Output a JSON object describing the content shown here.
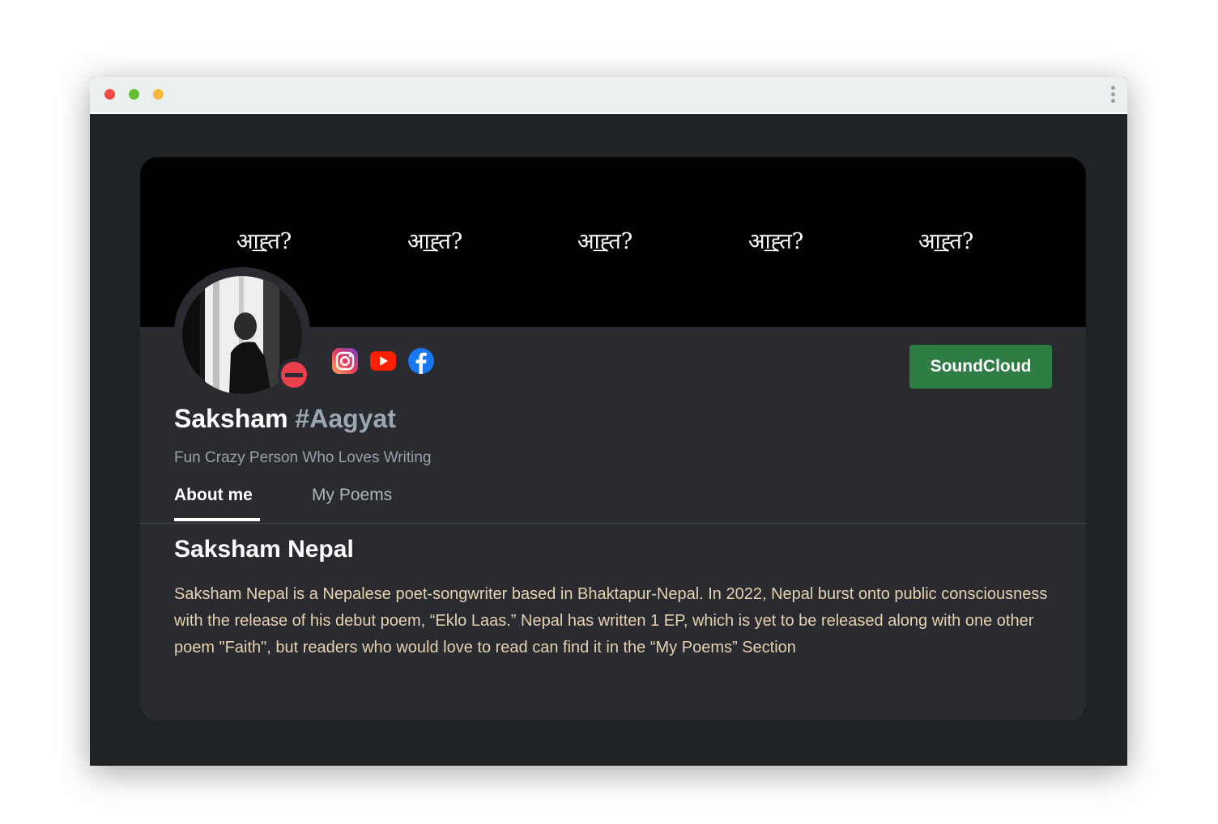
{
  "window": {
    "controls": [
      "close-dot",
      "minimize-dot",
      "maximize-dot"
    ],
    "menu_icon": "kebab-menu-icon"
  },
  "banner": {
    "texts": [
      "आ͟ह्त?",
      "आ͟ह्त?",
      "आ͟ह्त?",
      "आ͟ह्त?",
      "आ͟ह्त?"
    ]
  },
  "profile": {
    "name": "Saksham",
    "tag": "#Aagyat",
    "subtitle": "Fun Crazy Person Who Loves Writing",
    "social": [
      {
        "name": "instagram-icon",
        "color": "#d6249f"
      },
      {
        "name": "youtube-icon",
        "color": "#ff0000"
      },
      {
        "name": "facebook-icon",
        "color": "#1877f2"
      }
    ],
    "soundcloud_label": "SoundCloud"
  },
  "tabs": [
    {
      "label": "About me",
      "active": true
    },
    {
      "label": "My Poems",
      "active": false
    }
  ],
  "about": {
    "title": "Saksham Nepal",
    "text": "Saksham Nepal is a Nepalese poet-songwriter based in Bhaktapur-Nepal. In 2022, Nepal burst onto public consciousness with the release of his debut poem, “Eklo Laas.” Nepal has written 1 EP, which is yet to be released along with one other poem \"Faith\", but readers who would love to read can find it in the “My Poems” Section"
  },
  "colors": {
    "page_bg": "#1f2226",
    "card_bg": "#292b30",
    "accent_green": "#2e7d45",
    "about_text": "#e6d2b0"
  }
}
